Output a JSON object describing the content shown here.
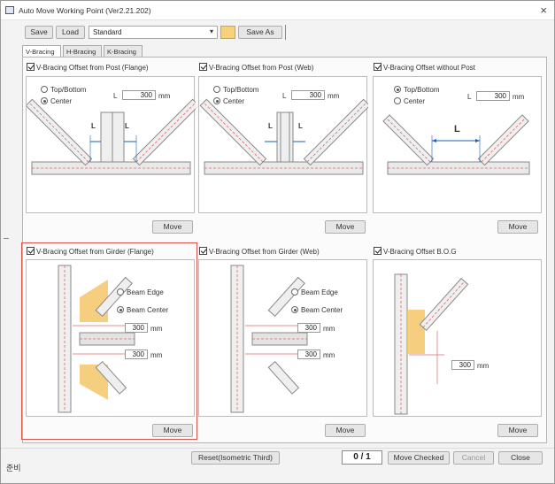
{
  "window": {
    "title": "Auto Move Working Point (Ver2.21.202)",
    "close": "×"
  },
  "toolbar": {
    "save": "Save",
    "load": "Load",
    "preset": "Standard",
    "save_as": "Save As"
  },
  "tabs": [
    "V-Bracing",
    "H-Bracing",
    "K-Bracing"
  ],
  "cells": [
    {
      "title": "V-Bracing Offset from Post (Flange)",
      "opt1": "Top/Bottom",
      "opt2": "Center",
      "len_label": "L",
      "len_value": "300",
      "unit": "mm",
      "dim": "L",
      "move": "Move"
    },
    {
      "title": "V-Bracing Offset from Post (Web)",
      "opt1": "Top/Bottom",
      "opt2": "Center",
      "len_label": "L",
      "len_value": "300",
      "unit": "mm",
      "dim": "L",
      "move": "Move"
    },
    {
      "title": "V-Bracing Offset without Post",
      "opt1": "Top/Bottom",
      "opt2": "Center",
      "len_label": "L",
      "len_value": "300",
      "unit": "mm",
      "dim": "L",
      "move": "Move"
    },
    {
      "title": "V-Bracing Offset from Girder (Flange)",
      "opt1": "Beam Edge",
      "opt2": "Beam Center",
      "val1": "300",
      "val2": "300",
      "unit": "mm",
      "move": "Move"
    },
    {
      "title": "V-Bracing Offset from Girder (Web)",
      "opt1": "Beam Edge",
      "opt2": "Beam Center",
      "val1": "300",
      "val2": "300",
      "unit": "mm",
      "move": "Move"
    },
    {
      "title": "V-Bracing Offset B.O.G",
      "val1": "300",
      "unit": "mm",
      "move": "Move"
    }
  ],
  "bottom": {
    "status": "준비",
    "reset": "Reset(Isometric Third)",
    "ratio": "0 / 1",
    "move_checked": "Move Checked",
    "cancel": "Cancel",
    "close": "Close"
  }
}
